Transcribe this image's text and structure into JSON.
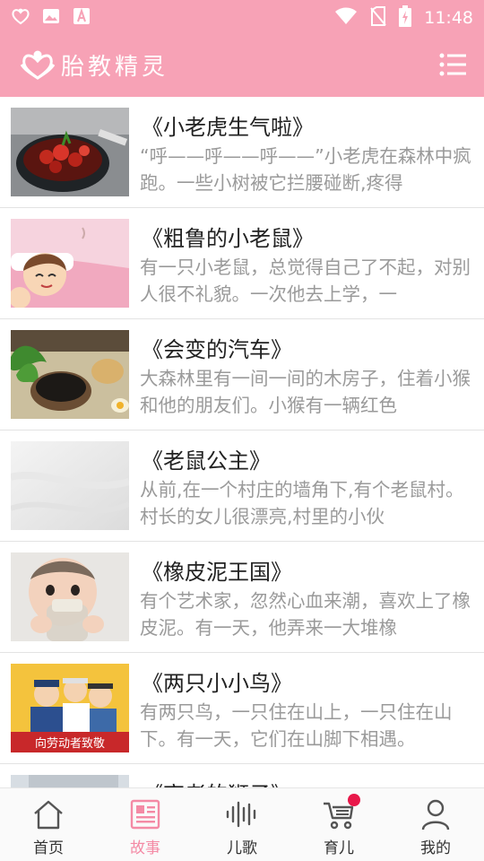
{
  "status_bar": {
    "time": "11:48",
    "left_icons": [
      "app-logo-icon",
      "image-icon",
      "store-a-icon"
    ],
    "right_icons": [
      "wifi-icon",
      "no-sim-icon",
      "battery-charging-icon"
    ]
  },
  "app_bar": {
    "title": "胎教精灵",
    "menu_icon": "list-menu-icon"
  },
  "colors": {
    "brand_pink": "#f7a2b6",
    "active_tab": "#f48aa5",
    "badge": "#e8184a"
  },
  "stories": [
    {
      "title": "《小老虎生气啦》",
      "desc": "“呼——呼——呼——”小老虎在森林中疯跑。一些小树被它拦腰碰断,疼得"
    },
    {
      "title": "《粗鲁的小老鼠》",
      "desc": "有一只小老鼠，总觉得自己了不起，对别人很不礼貌。一次他去上学，一"
    },
    {
      "title": "《会变的汽车》",
      "desc": "大森林里有一间一间的木房子，住着小猴和他的朋友们。小猴有一辆红色"
    },
    {
      "title": "《老鼠公主》",
      "desc": "从前,在一个村庄的墙角下,有个老鼠村。村长的女儿很漂亮,村里的小伙"
    },
    {
      "title": "《橡皮泥王国》",
      "desc": "有个艺术家，忽然心血来潮，喜欢上了橡皮泥。有一天，他弄来一大堆橡"
    },
    {
      "title": "《两只小小鸟》",
      "desc": "有两只鸟，一只住在山上，一只住在山下。有一天，它们在山脚下相遇。"
    },
    {
      "title": "《高老的狮子》",
      "desc": ""
    }
  ],
  "thumb_overlay_text": "向劳动者致敬",
  "bottom_nav": [
    {
      "label": "首页",
      "icon": "home-icon",
      "active": false
    },
    {
      "label": "故事",
      "icon": "story-book-icon",
      "active": true
    },
    {
      "label": "儿歌",
      "icon": "sound-wave-icon",
      "active": false
    },
    {
      "label": "育儿",
      "icon": "stroller-icon",
      "active": false,
      "badge": true
    },
    {
      "label": "我的",
      "icon": "profile-icon",
      "active": false
    }
  ]
}
